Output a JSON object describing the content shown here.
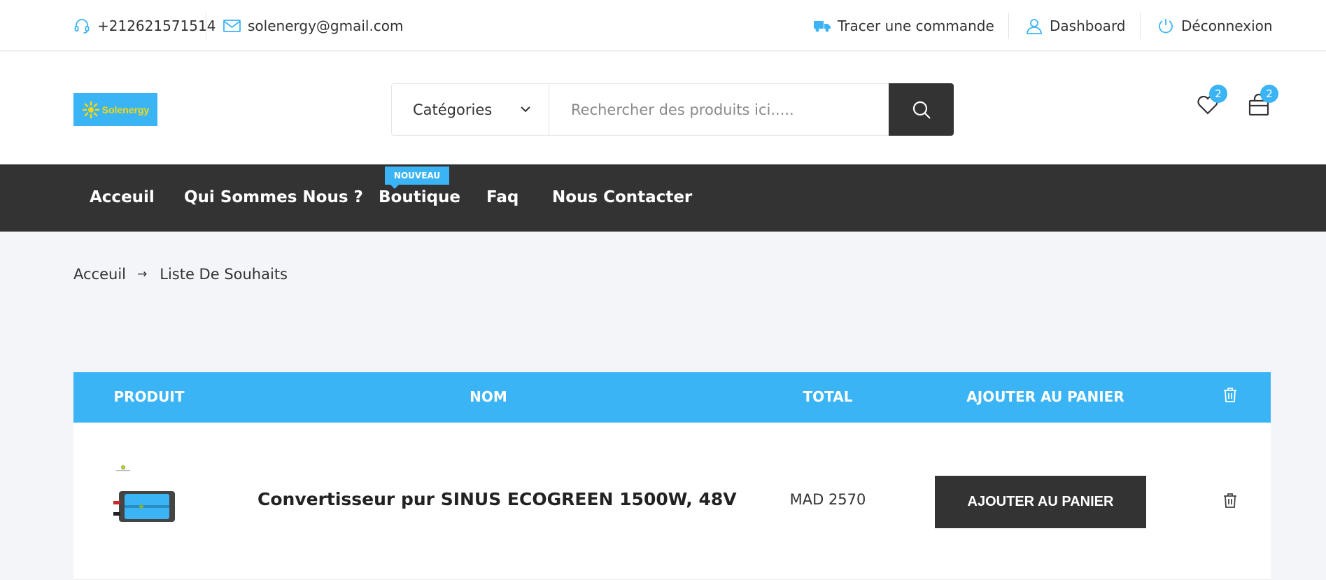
{
  "topbar": {
    "phone": "+212621571514",
    "email": "solenergy@gmail.com",
    "track_order": "Tracer une commande",
    "dashboard": "Dashboard",
    "logout": "Déconnexion"
  },
  "header": {
    "logo_text": "Solenergy",
    "categories_label": "Catégories",
    "search_placeholder": "Rechercher des produits ici.....",
    "wishlist_count": "2",
    "cart_count": "2"
  },
  "nav": {
    "items": [
      "Acceuil",
      "Qui Sommes Nous ?",
      "Boutique",
      "Faq",
      "Nous Contacter"
    ],
    "new_badge": "NOUVEAU"
  },
  "breadcrumb": {
    "home": "Acceuil",
    "current": "Liste De Souhaits"
  },
  "table": {
    "headers": [
      "PRODUIT",
      "NOM",
      "TOTAL",
      "AJOUTER AU PANIER"
    ],
    "rows": [
      {
        "name": "Convertisseur pur SINUS ECOGREEN 1500W, 48V",
        "total": "MAD 2570",
        "add_label": "AJOUTER AU PANIER"
      }
    ]
  },
  "colors": {
    "accent": "#3bb4f5",
    "dark": "#333333",
    "logo_text": "#f5d90a"
  }
}
